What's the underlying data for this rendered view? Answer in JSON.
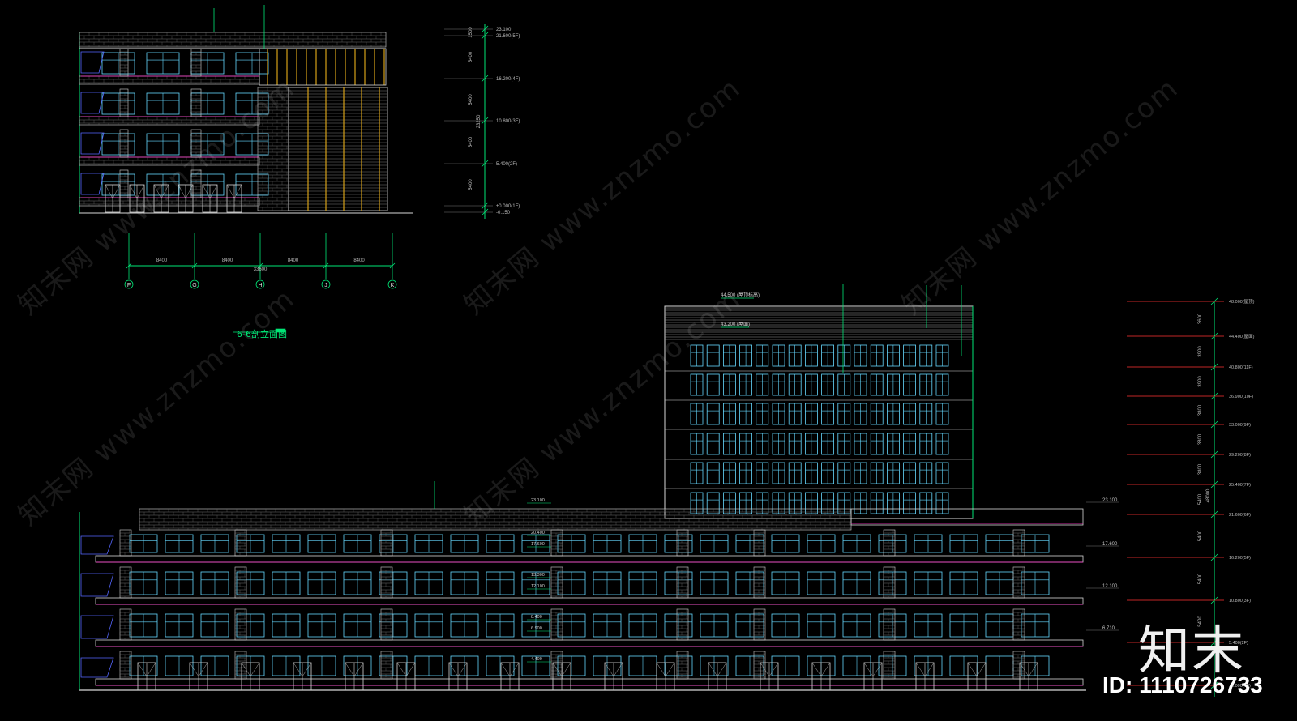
{
  "drawing": {
    "caption": "6-6剖立面图",
    "axis_labels": [
      "F",
      "G",
      "H",
      "J",
      "K"
    ],
    "bay_dims": [
      "8400",
      "8400",
      "8400",
      "8400"
    ],
    "total_dim": "33600",
    "upper_levels": [
      "23.100",
      "21.600(5F)",
      "16.200(4F)",
      "10.800(3F)",
      "5.400(2F)",
      "±0.000(1F)",
      "-0.150"
    ],
    "upper_spans": [
      "1500",
      "5400",
      "5400",
      "5400",
      "5400"
    ],
    "upper_total": "23250",
    "main_levels": [
      "48.000(屋顶)",
      "44.400(屋面)",
      "40.800(11F)",
      "36.900(10F)",
      "33.000(9F)",
      "29.200(8F)",
      "25.400(7F)",
      "21.600(6F)",
      "16.200(5F)",
      "10.800(3F)",
      "5.400(2F)",
      "±0.000(1F)"
    ],
    "main_spans": [
      "3600",
      "3900",
      "3900",
      "3800",
      "3800",
      "3800",
      "5400",
      "5400",
      "5400",
      "5400"
    ],
    "main_total": "48000",
    "podium_marks": [
      "23.100",
      "17.600",
      "12.100",
      "6.710"
    ],
    "tower_marks": [
      "44.500 (屋顶标高)",
      "43.200 (屋面)"
    ],
    "inline_marks": [
      "23.100",
      "20.400",
      "17.600",
      "13.300",
      "12.100",
      "8.400",
      "6.900",
      "4.400"
    ]
  },
  "watermark": {
    "text": "知末网 www.znzmo.com"
  },
  "brand": {
    "logo": "知末",
    "id": "ID: 1110726733"
  },
  "colors": {
    "outline": "#d8d8d8",
    "green": "#00e676",
    "magenta": "#ff33cc",
    "cyan": "#66d9ff",
    "yellow": "#d4a017",
    "red": "#ff3333"
  }
}
